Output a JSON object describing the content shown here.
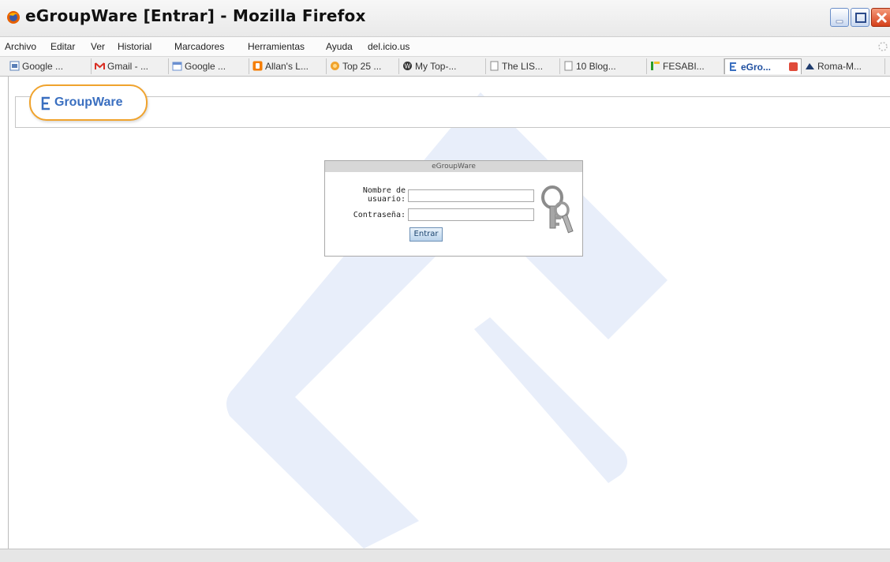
{
  "window": {
    "title": "eGroupWare [Entrar] - Mozilla Firefox"
  },
  "menu": [
    "Archivo",
    "Editar",
    "Ver",
    "Historial",
    "Marcadores",
    "Herramientas",
    "Ayuda",
    "del.icio.us"
  ],
  "tabs": [
    {
      "label": "Google ...",
      "icon": "google-doc-icon",
      "color": "#5a7fb8"
    },
    {
      "label": "Gmail - ...",
      "icon": "gmail-icon",
      "color": "#d93025"
    },
    {
      "label": "Google ...",
      "icon": "google-calendar-icon",
      "color": "#6a8fd0"
    },
    {
      "label": "Allan's L...",
      "icon": "blogger-icon",
      "color": "#f57d00"
    },
    {
      "label": "Top 25 ...",
      "icon": "orange-circle-icon",
      "color": "#f0a32d"
    },
    {
      "label": "My Top-...",
      "icon": "wordpress-icon",
      "color": "#333333"
    },
    {
      "label": "The LIS...",
      "icon": "page-icon",
      "color": "#8a8a8a"
    },
    {
      "label": "10 Blog...",
      "icon": "page-icon",
      "color": "#8a8a8a"
    },
    {
      "label": "FESABI...",
      "icon": "fesabi-icon",
      "color": "#2a9d2a"
    },
    {
      "label": "eGro...",
      "icon": "egroupware-icon",
      "color": "#3a6fc0",
      "active": true
    },
    {
      "label": "Roma-M...",
      "icon": "roma-icon",
      "color": "#1f3c6e"
    }
  ],
  "logo": {
    "text": "GroupWare"
  },
  "login": {
    "header": "eGroupWare",
    "username_label": "Nombre de usuario:",
    "password_label": "Contraseña:",
    "submit_label": "Entrar",
    "username_value": "",
    "password_value": ""
  },
  "colors": {
    "accent": "#3a6fc0",
    "logo_border": "#f0a32d",
    "watermark": "#e6edf9"
  }
}
